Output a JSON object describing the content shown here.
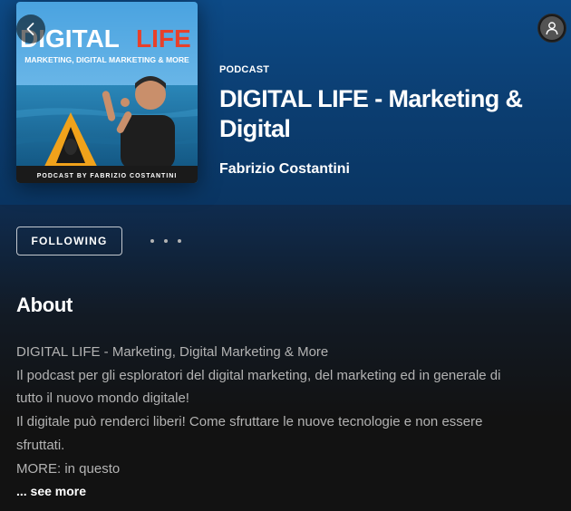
{
  "navigation": {
    "back_icon": "chevron-left-icon",
    "profile_icon": "user-icon"
  },
  "cover": {
    "title_left": "DIGITAL",
    "title_right": "LIFE",
    "subtitle": "MARKETING, DIGITAL MARKETING & MORE",
    "footer": "PODCAST BY FABRIZIO COSTANTINI",
    "colors": {
      "title_red": "#e8402a",
      "sea": "#1a6fa0",
      "sky": "#5fb2e6",
      "kayak": "#f0a21b"
    }
  },
  "show": {
    "type_label": "PODCAST",
    "title": "DIGITAL LIFE - Marketing & Digital",
    "author": "Fabrizio Costantini"
  },
  "actions": {
    "following_label": "FOLLOWING",
    "more_icon": "more-options-icon"
  },
  "about": {
    "heading": "About",
    "lines": [
      "DIGITAL LIFE - Marketing, Digital Marketing & More",
      "Il podcast per gli esploratori del digital marketing, del marketing ed in generale di",
      "tutto il nuovo mondo digitale!",
      "Il digitale può renderci liberi! Come sfruttare le nuove tecnologie e non essere",
      "sfruttati.",
      "MORE: in questo"
    ],
    "see_more_label": "... see more"
  },
  "colors": {
    "header_blue": "#0b3d70",
    "background": "#121212",
    "muted_text": "#b3b3b3"
  }
}
